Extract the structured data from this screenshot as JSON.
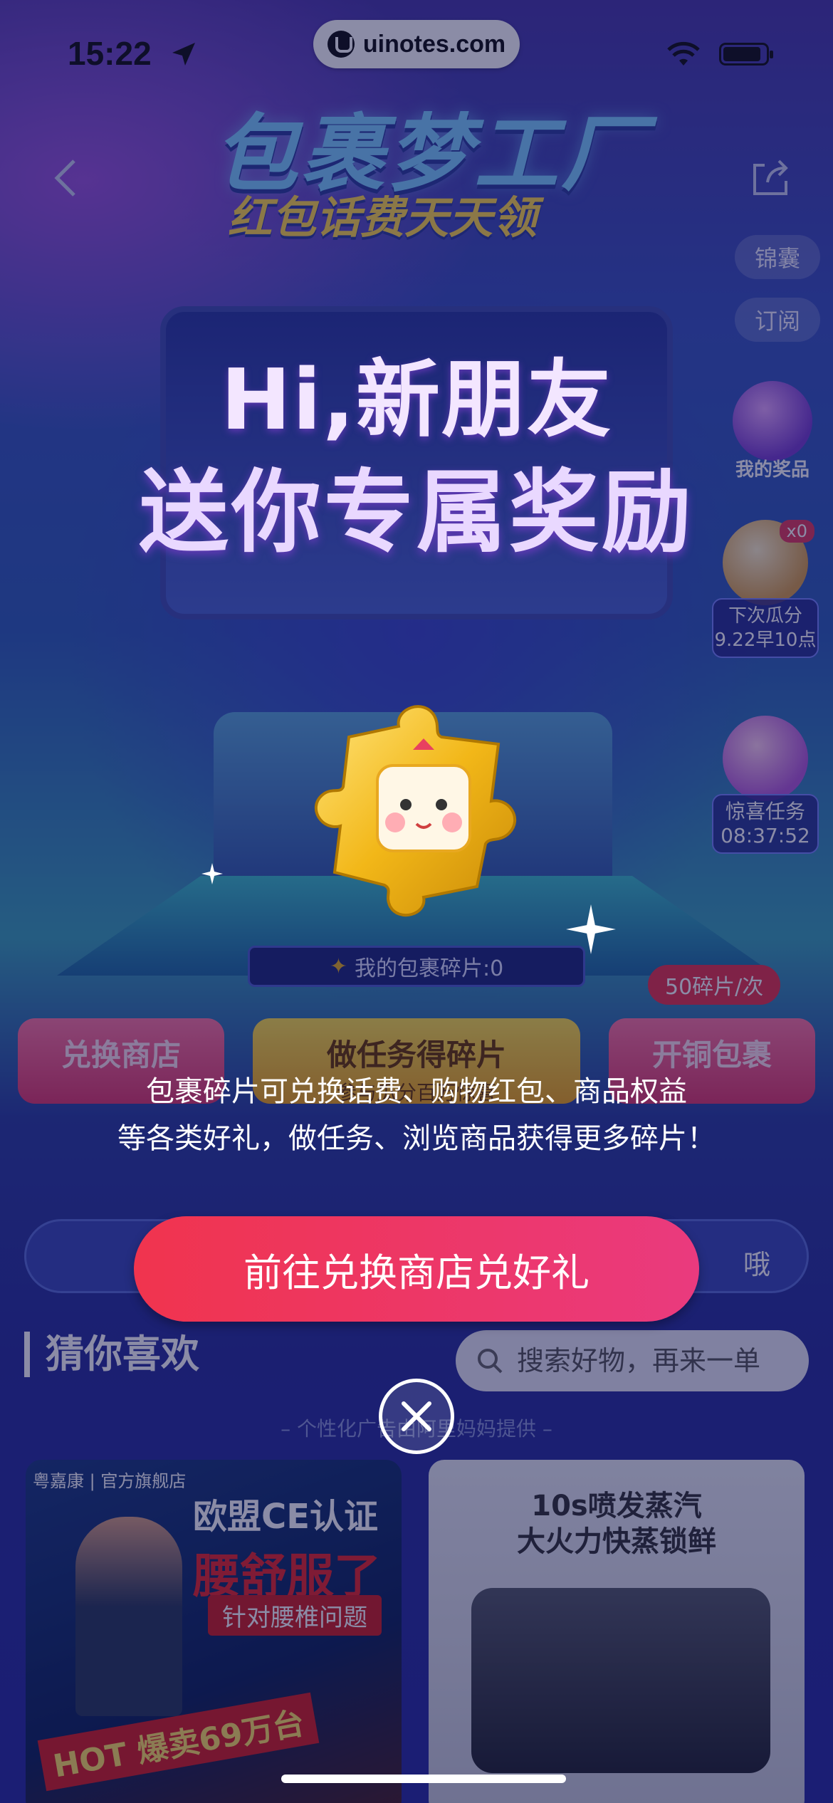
{
  "status_bar": {
    "time": "15:22",
    "watermark": "uinotes.com"
  },
  "hero": {
    "title": "包裹梦工厂",
    "subtitle": "红包话费天天领"
  },
  "side_menu": {
    "pouch_label": "锦囊",
    "subscribe_label": "订阅",
    "my_prize_label": "我的奖品",
    "next_share_badge": "x0",
    "next_share_line1": "下次瓜分",
    "next_share_line2": "9.22早10点",
    "surprise_task_label": "惊喜任务",
    "surprise_task_timer": "08:37:52"
  },
  "game": {
    "fragment_count": "我的包裹碎片:0",
    "open_price": "50碎片/次",
    "store_button": "兑换商店",
    "task_button": "做任务得碎片",
    "task_button_sub": "参与瓜分百万惊喜",
    "open_button": "开铜包裹"
  },
  "notice": {
    "trailing_text": "哦"
  },
  "recommend": {
    "title": "猜你喜欢",
    "search_placeholder": "搜索好物，再来一单",
    "ad_note": "– 个性化广告由阿里妈妈提供 –"
  },
  "products": [
    {
      "brand": "粤嘉康 | 官方旗舰店",
      "headline": "欧盟CE认证",
      "headline2": "腰舒服了",
      "tag": "针对腰椎问题",
      "hot": "HOT 爆卖69万台"
    },
    {
      "headline": "10s喷发蒸汽\n大火力快蒸锁鲜"
    }
  ],
  "popup": {
    "title_line1": "Hi,新朋友",
    "title_line2": "送你专属奖励",
    "description_line1": "包裹碎片可兑换话费、购物红包、商品权益",
    "description_line2": "等各类好礼，做任务、浏览商品获得更多碎片！",
    "cta_label": "前往兑换商店兑好礼"
  },
  "colors": {
    "cta_start": "#f0344e",
    "cta_end": "#ea3a7e",
    "background": "#2a2da0"
  }
}
